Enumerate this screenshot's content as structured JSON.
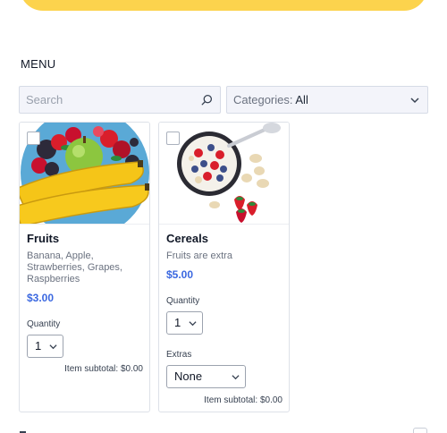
{
  "menu": {
    "heading": "MENU"
  },
  "search": {
    "placeholder": "Search",
    "value": ""
  },
  "categories": {
    "label": "Categories:",
    "selected": "All"
  },
  "products": [
    {
      "title": "Fruits",
      "description": "Banana, Apple, Strawberries, Grapes, Raspberries",
      "price": "$3.00",
      "quantity_label": "Quantity",
      "quantity_value": "1",
      "subtotal_label": "Item subtotal:",
      "subtotal_value": "$0.00"
    },
    {
      "title": "Cereals",
      "description": "Fruits are extra",
      "price": "$5.00",
      "quantity_label": "Quantity",
      "quantity_value": "1",
      "extras_label": "Extras",
      "extras_value": "None",
      "subtotal_label": "Item subtotal:",
      "subtotal_value": "$0.00"
    }
  ],
  "colors": {
    "banner": "#fcd34d",
    "price": "#3b68e0",
    "field_bg": "#f3f4fa"
  },
  "icons": {
    "search": "search-icon",
    "dropdown": "chevron-down-icon"
  }
}
